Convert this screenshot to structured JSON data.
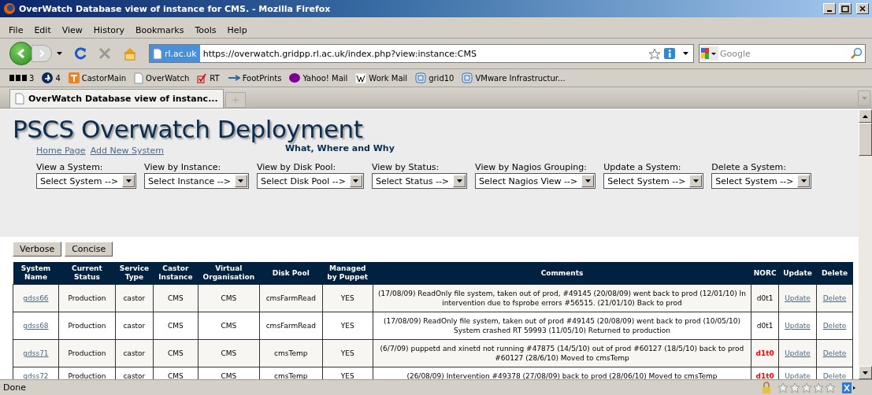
{
  "window": {
    "title": "OverWatch Database view of instance for CMS. - Mozilla Firefox"
  },
  "menu": [
    "File",
    "Edit",
    "View",
    "History",
    "Bookmarks",
    "Tools",
    "Help"
  ],
  "address_bar": {
    "site": "rl.ac.uk",
    "url": "https://overwatch.gridpp.rl.ac.uk/index.php?view:instance:CMS"
  },
  "search": {
    "placeholder": "Google"
  },
  "bookmarks": [
    {
      "label": "3",
      "kind": "bbc"
    },
    {
      "label": "4",
      "kind": "four"
    },
    {
      "label": "CastorMain",
      "kind": "castor"
    },
    {
      "label": "OverWatch",
      "kind": "page"
    },
    {
      "label": "RT",
      "kind": "check"
    },
    {
      "label": "FootPrints",
      "kind": "footprints"
    },
    {
      "label": "Yahoo! Mail",
      "kind": "yahoo"
    },
    {
      "label": "Work Mail",
      "kind": "wiki"
    },
    {
      "label": "grid10",
      "kind": "vmware"
    },
    {
      "label": "VMware Infrastructur...",
      "kind": "vmware"
    }
  ],
  "tabs": [
    {
      "label": "OverWatch Database view of instanc...",
      "selected": true
    }
  ],
  "page": {
    "title": "PSCS Overwatch Deployment",
    "links": [
      "Home Page",
      "Add New System"
    ],
    "tagline": "What, Where and Why",
    "selectors": [
      {
        "label": "View a System:",
        "value": "Select System -->"
      },
      {
        "label": "View by Instance:",
        "value": "Select Instance -->"
      },
      {
        "label": "View by Disk Pool:",
        "value": "Select Disk Pool -->"
      },
      {
        "label": "View by Status:",
        "value": "Select Status -->"
      },
      {
        "label": "View by Nagios Grouping:",
        "value": "Select Nagios View -->"
      },
      {
        "label": "Update a System:",
        "value": "Select System -->"
      },
      {
        "label": "Delete a System:",
        "value": "Select System -->"
      }
    ],
    "buttons": [
      "Verbose",
      "Concise"
    ]
  },
  "table": {
    "columns": [
      "System Name",
      "Current Status",
      "Service Type",
      "Castor Instance",
      "Virtual Organisation",
      "Disk Pool",
      "Managed by Puppet",
      "Comments",
      "NORC",
      "Update",
      "Delete"
    ],
    "rows": [
      {
        "system": "gdss66",
        "status": "Production",
        "service": "castor",
        "instance": "CMS",
        "vo": "CMS",
        "pool": "cmsFarmRead",
        "puppet": "YES",
        "comments": "(17/08/09) ReadOnly file system, taken out of prod, #49145 (20/08/09) went back to prod (12/01/10) In intervention due to fsprobe errors #56515. (21/01/10) Back to prod",
        "norc": "d0t1",
        "alert": false,
        "update": "Update",
        "delete": "Delete"
      },
      {
        "system": "gdss68",
        "status": "Production",
        "service": "castor",
        "instance": "CMS",
        "vo": "CMS",
        "pool": "cmsFarmRead",
        "puppet": "YES",
        "comments": "(17/08/09) ReadOnly file system, taken out of prod #49145 (20/08/09) went back to prod (10/05/10) System crashed RT 59993 (11/05/10) Returned to production",
        "norc": "d0t1",
        "alert": false,
        "update": "Update",
        "delete": "Delete"
      },
      {
        "system": "gdss71",
        "status": "Production",
        "service": "castor",
        "instance": "CMS",
        "vo": "CMS",
        "pool": "cmsTemp",
        "puppet": "YES",
        "comments": "(6/7/09) puppetd and xinetd not running #47875 (14/5/10) out of prod #60127 (18/5/10) back to prod #60127 (28/6/10) Moved to cmsTemp",
        "norc": "d1t0",
        "alert": true,
        "update": "Update",
        "delete": "Delete"
      },
      {
        "system": "gdss72",
        "status": "Production",
        "service": "castor",
        "instance": "CMS",
        "vo": "CMS",
        "pool": "cmsTemp",
        "puppet": "YES",
        "comments": "(26/08/09) Intervention #49378 (27/08/09) back to prod (28/06/10) Moved to cmsTemp",
        "norc": "d1t0",
        "alert": true,
        "update": "Update",
        "delete": "Delete"
      }
    ]
  },
  "status_bar": {
    "text": "Done",
    "rating": {
      "stars": 0
    }
  }
}
